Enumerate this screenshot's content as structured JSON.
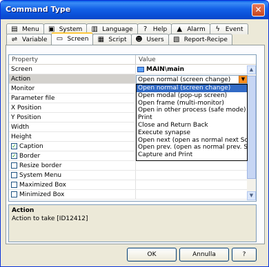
{
  "window": {
    "title": "Command Type",
    "close_glyph": "✕"
  },
  "tabs": {
    "row1": [
      {
        "label": "Menu",
        "icon": "menu-icon",
        "glyph": "▤"
      },
      {
        "label": "System",
        "icon": "system-icon",
        "glyph": "▣"
      },
      {
        "label": "Language",
        "icon": "language-icon",
        "glyph": "▥"
      },
      {
        "label": "Help",
        "icon": "help-icon",
        "glyph": "?"
      },
      {
        "label": "Alarm",
        "icon": "alarm-icon",
        "glyph": "▲"
      },
      {
        "label": "Event",
        "icon": "event-icon",
        "glyph": "ϟ"
      }
    ],
    "row2": [
      {
        "label": "Variable",
        "icon": "variable-icon",
        "glyph": "⇌"
      },
      {
        "label": "Screen",
        "icon": "screen-icon",
        "glyph": "▭"
      },
      {
        "label": "Script",
        "icon": "script-icon",
        "glyph": "▦"
      },
      {
        "label": "Users",
        "icon": "users-icon",
        "glyph": "☻"
      },
      {
        "label": "Report-Recipe",
        "icon": "report-recipe-icon",
        "glyph": "▧"
      }
    ],
    "active": "Screen"
  },
  "grid": {
    "headers": {
      "property": "Property",
      "value": "Value"
    },
    "rows": [
      {
        "label": "Screen",
        "value": "MAIN\\main",
        "bold": true,
        "icon": "screen-value-icon"
      },
      {
        "label": "Action",
        "value": "Open normal (screen change)",
        "selected": true
      },
      {
        "label": "Monitor",
        "value": ""
      },
      {
        "label": "Parameter file",
        "value": ""
      },
      {
        "label": "X Position",
        "value": ""
      },
      {
        "label": "Y Position",
        "value": ""
      },
      {
        "label": "Width",
        "value": ""
      },
      {
        "label": "Height",
        "value": ""
      },
      {
        "label": "Caption",
        "value": "",
        "checkbox": true,
        "checked": true
      },
      {
        "label": "Border",
        "value": "",
        "checkbox": true,
        "checked": true
      },
      {
        "label": "Resize border",
        "value": "",
        "checkbox": true,
        "checked": false
      },
      {
        "label": "System Menu",
        "value": "",
        "checkbox": true,
        "checked": false
      },
      {
        "label": "Maximized Box",
        "value": "",
        "checkbox": true,
        "checked": false
      },
      {
        "label": "Minimized Box",
        "value": "",
        "checkbox": true,
        "checked": false
      }
    ]
  },
  "combo": {
    "value": "Open normal (screen change)",
    "arrow": "▼"
  },
  "dropdown": {
    "options": [
      "Open normal (screen change)",
      "Open modal (pop-up screen)",
      "Open frame (multi-monitor)",
      "Open in other process (safe mode)",
      "Print",
      "Close and Return Back",
      "Execute synapse",
      "Open next (open as normal next Screen",
      "Open prev. (open as normal prev. Scree",
      "Capture and Print"
    ],
    "highlighted_index": 0
  },
  "description": {
    "title": "Action",
    "text": "Action to take [ID12412]"
  },
  "buttons": {
    "ok": "OK",
    "cancel": "Annulla",
    "help": "?"
  },
  "scrollbar": {
    "up": "▲",
    "down": "▼"
  },
  "colors": {
    "title_bar": "#0a5ee8",
    "selection": "#316ac5",
    "combo_button": "#ff8c1a"
  }
}
